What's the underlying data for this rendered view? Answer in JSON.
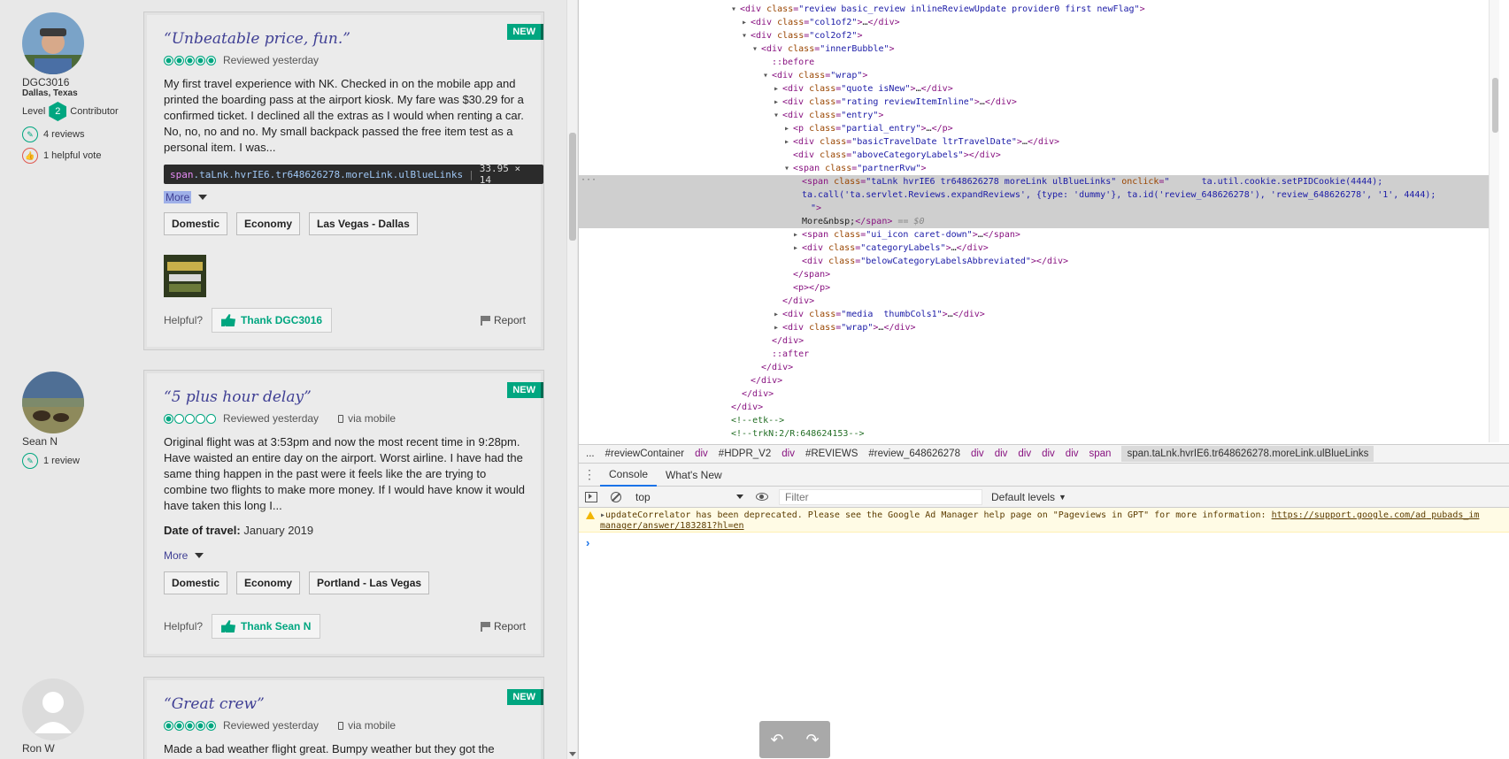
{
  "reviews": [
    {
      "user": {
        "name": "DGC3016",
        "location": "Dallas, Texas",
        "level_label": "Level",
        "level": "2",
        "level_title": "Contributor",
        "reviews": "4 reviews",
        "votes": "1 helpful vote"
      },
      "badge": "NEW",
      "title": "“Unbeatable price, fun.”",
      "rating": 5,
      "date": "Reviewed yesterday",
      "text": "My first travel experience with NK. Checked in on the mobile app and printed the boarding pass at the airport kiosk. My fare was $30.29 for a confirmed ticket. I declined all the extras as I would when renting a car. No, no, no and no. My small backpack passed the free item test as a personal item. I was...",
      "more": "More",
      "tags": [
        "Domestic",
        "Economy",
        "Las Vegas - Dallas"
      ],
      "helpful": "Helpful?",
      "thank": "Thank DGC3016",
      "report": "Report"
    },
    {
      "user": {
        "name": "Sean N",
        "reviews": "1 review"
      },
      "badge": "NEW",
      "title": "“5 plus hour delay”",
      "rating": 1,
      "date": "Reviewed yesterday",
      "via": "via mobile",
      "text": "Original flight was at 3:53pm and now the most recent time in 9:28pm. Have waisted an entire day on the airport. Worst airline. I have had the same thing happen in the past were it feels like the are trying to combine two flights to make more money. If I would have know it would have taken this long I...",
      "travel_label": "Date of travel:",
      "travel_date": "January 2019",
      "more": "More",
      "tags": [
        "Domestic",
        "Economy",
        "Portland - Las Vegas"
      ],
      "helpful": "Helpful?",
      "thank": "Thank Sean N",
      "report": "Report"
    },
    {
      "user": {
        "name": "Ron W"
      },
      "badge": "NEW",
      "title": "“Great crew”",
      "rating": 5,
      "date": "Reviewed yesterday",
      "via": "via mobile",
      "text": "Made a bad weather flight great. Bumpy weather but they got the"
    }
  ],
  "tooltip": {
    "tag": "span",
    "classes": ".taLnk.hvrIE6.tr648626278.moreLink.ulBlueLinks",
    "size": "33.95 × 14"
  },
  "devtools": {
    "breadcrumbs": [
      "...",
      "#reviewContainer",
      "div",
      "#HDPR_V2",
      "div",
      "#REVIEWS",
      "#review_648626278",
      "div",
      "div",
      "div",
      "div",
      "div",
      "span",
      "span.taLnk.hvrIE6.tr648626278.moreLink.ulBlueLinks"
    ],
    "drawer_tabs": [
      "Console",
      "What's New"
    ],
    "context": "top",
    "filter_placeholder": "Filter",
    "levels": "Default levels",
    "warning_line1": "updateCorrelator has been deprecated. Please see the Google Ad Manager help page on \"Pageviews in GPT\" for more information: ",
    "warning_link": "https://support.google.com/ad",
    "warning_tail": " pubads_im",
    "warning_line2": "manager/answer/183281?hl=en",
    "undo": "↶",
    "redo": "↷"
  }
}
